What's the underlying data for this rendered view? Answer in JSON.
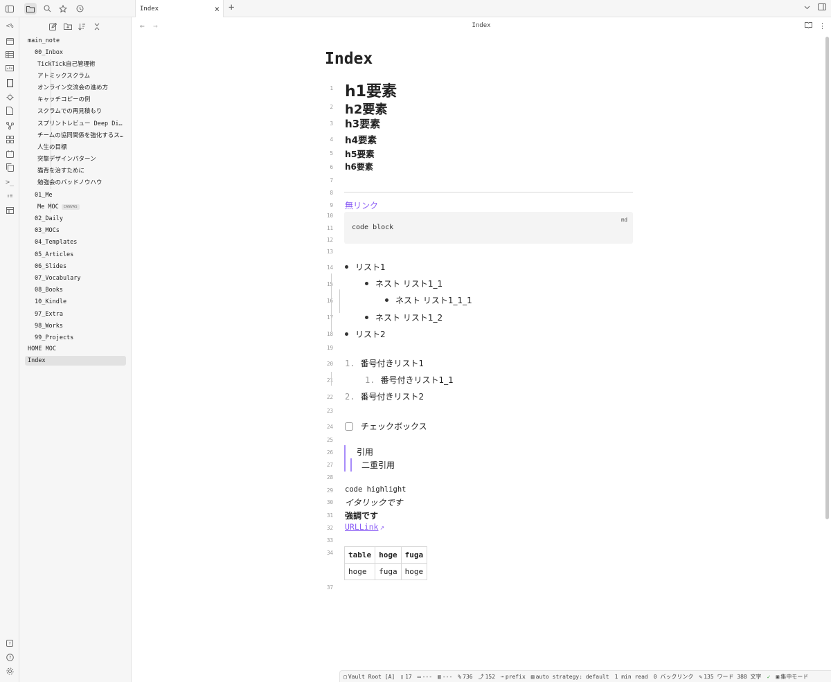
{
  "tab": {
    "title": "Index"
  },
  "sidebar": {
    "root": "main_note",
    "inbox_folder": "00_Inbox",
    "inbox_items": [
      "TickTick自己管理術",
      "アトミックスクラム",
      "オンライン交流会の進め方",
      "キャッチコピーの例",
      "スクラムでの再見積もり",
      "スプリントレビュー Deep Di…",
      "チームの協同関係を強化するス…",
      "人生の目標",
      "突撃デザインパターン",
      "猫背を治すために",
      "勉強会のバッドノウハウ"
    ],
    "me_folder": "01_Me",
    "me_item": "Me MOC",
    "canvas_badge": "CANVAS",
    "folders": [
      "02_Daily",
      "03_MOCs",
      "04_Templates",
      "05_Articles",
      "06_Slides",
      "07_Vocabulary",
      "08_Books",
      "10_Kindle",
      "97_Extra",
      "98_Works",
      "99_Projects"
    ],
    "home_moc": "HOME MOC",
    "index": "Index"
  },
  "pane": {
    "title": "Index"
  },
  "doc": {
    "title": "Index",
    "h1": "h1要素",
    "h2": "h2要素",
    "h3": "h3要素",
    "h4": "h4要素",
    "h5": "h5要素",
    "h6": "h6要素",
    "nolink": "無リンク",
    "code": "code block",
    "code_lang": "md",
    "list1": "リスト1",
    "nest1_1": "ネスト リスト1_1",
    "nest1_1_1": "ネスト リスト1_1_1",
    "nest1_2": "ネスト リスト1_2",
    "list2": "リスト2",
    "ol1_num": "1.",
    "ol1": "番号付きリスト1",
    "ol1_1_num": "1.",
    "ol1_1": "番号付きリスト1_1",
    "ol2_num": "2.",
    "ol2": "番号付きリスト2",
    "checkbox": "チェックボックス",
    "quote": "引用",
    "quote2": "二重引用",
    "code_highlight": "code highlight",
    "italic": "イタリックです",
    "bold": "強調です",
    "url": "URLLink",
    "table": [
      [
        "table",
        "hoge",
        "fuga"
      ],
      [
        "hoge",
        "fuga",
        "hoge"
      ]
    ],
    "line_numbers": [
      "1",
      "2",
      "3",
      "4",
      "5",
      "6",
      "7",
      "8",
      "9",
      "10",
      "11",
      "12",
      "13",
      "14",
      "15",
      "16",
      "17",
      "18",
      "19",
      "20",
      "21",
      "22",
      "23",
      "24",
      "25",
      "26",
      "27",
      "28",
      "29",
      "30",
      "31",
      "32",
      "33",
      "34",
      "37"
    ]
  },
  "status": {
    "vault": "Vault Root [A]",
    "s1": "17",
    "s2": "---",
    "s3": "---",
    "s4": "736",
    "s5": "152",
    "prefix": "prefix",
    "auto": "auto strategy: default",
    "read": "1 min read",
    "backlinks": "0 バックリンク",
    "words": "135 ワード 388 文字",
    "focus": "集中モード"
  }
}
